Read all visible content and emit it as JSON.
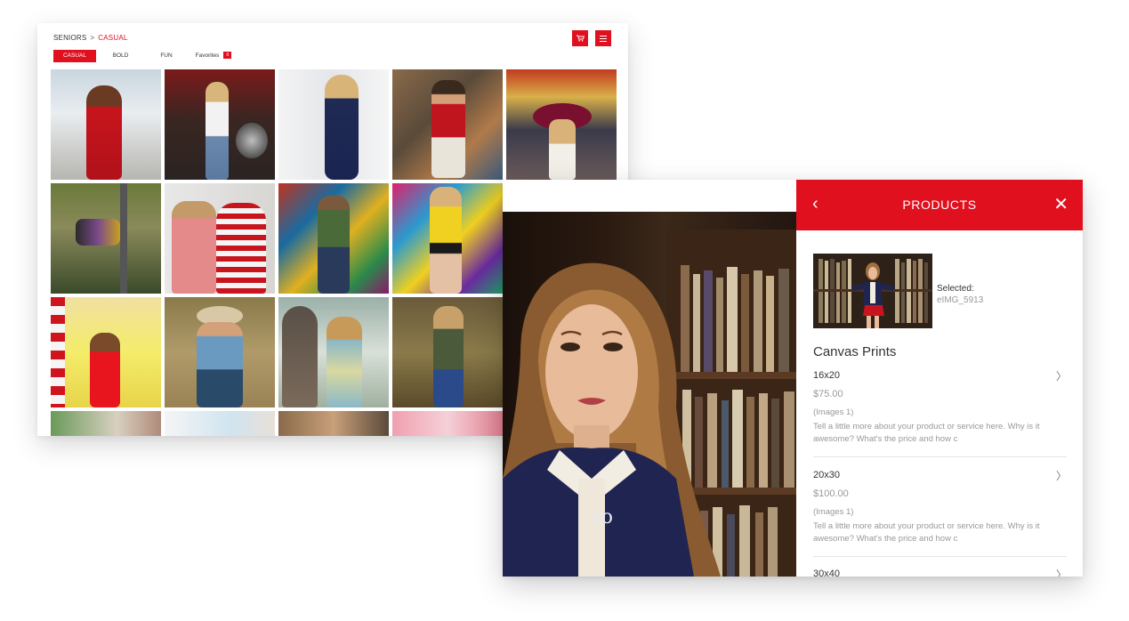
{
  "gallery": {
    "breadcrumb": {
      "parent": "SENIORS",
      "separator": ">",
      "current": "CASUAL"
    },
    "header_buttons": {
      "cart_icon": "cart-icon",
      "menu_icon": "menu-icon"
    },
    "tabs": [
      {
        "label": "CASUAL",
        "active": true
      },
      {
        "label": "BOLD",
        "active": false
      },
      {
        "label": "FUN",
        "active": false
      },
      {
        "label": "Favorites",
        "active": false,
        "badge": "0"
      }
    ],
    "photos": [
      {
        "label": "red dress bandana marina"
      },
      {
        "label": "drum set stage"
      },
      {
        "label": "navy dress white wall"
      },
      {
        "label": "red shirt graffiti stairs"
      },
      {
        "label": "red hat tattoo sign"
      },
      {
        "label": "hanging pole"
      },
      {
        "label": "striped sweater sunglasses"
      },
      {
        "label": "green shirt brick mural"
      },
      {
        "label": "yellow cardigan mural"
      },
      {
        "label": "red dress slide"
      },
      {
        "label": "cowboy hat hay"
      },
      {
        "label": "horse and girl"
      },
      {
        "label": "olive jacket hay"
      },
      {
        "label": "row partial 1"
      },
      {
        "label": "row partial 2"
      },
      {
        "label": "row partial 3"
      },
      {
        "label": "row partial 4"
      }
    ]
  },
  "viewer": {
    "panel": {
      "title": "PRODUCTS",
      "back_icon": "chevron-left-icon",
      "close_icon": "close-icon",
      "selected_label": "Selected:",
      "selected_value": "eIMG_5913",
      "section_title": "Canvas Prints",
      "products": [
        {
          "size": "16x20",
          "price": "$75.00",
          "images": "(Images 1)",
          "description": "Tell a little more about your product or service here. Why is it awesome? What's the price and how c"
        },
        {
          "size": "20x30",
          "price": "$100.00",
          "images": "(Images 1)",
          "description": "Tell a little more about your product or service here. Why is it awesome? What's the price and how c"
        },
        {
          "size": "30x40"
        }
      ]
    }
  },
  "colors": {
    "accent": "#e0101f",
    "muted_text": "#999999"
  }
}
